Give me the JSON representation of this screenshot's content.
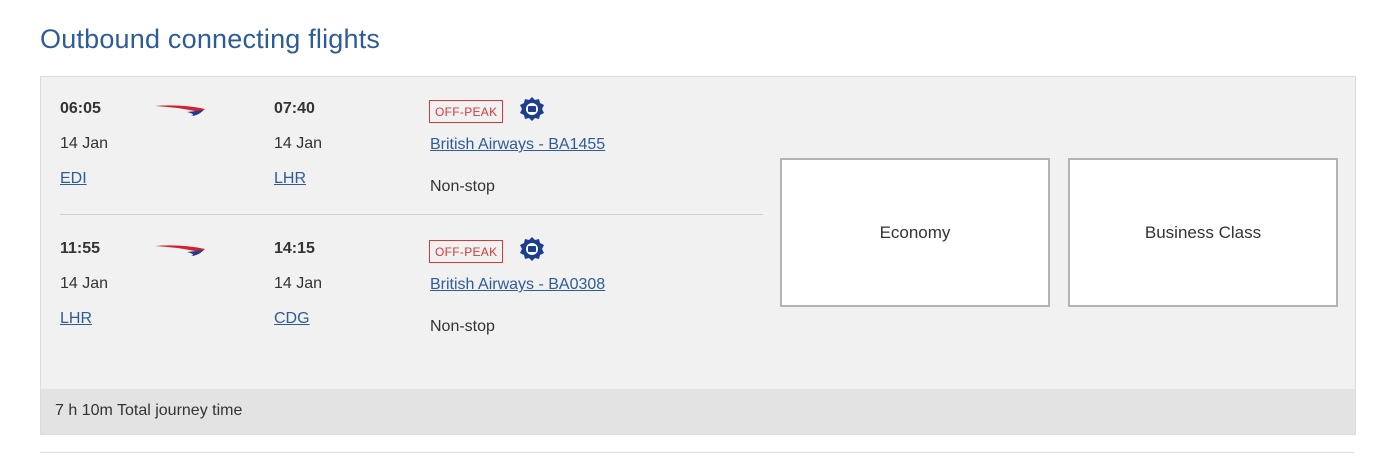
{
  "page_title": "Outbound connecting flights",
  "segments": [
    {
      "departure": {
        "time": "06:05",
        "date": "14 Jan",
        "airport": "EDI"
      },
      "arrival": {
        "time": "07:40",
        "date": "14 Jan",
        "airport": "LHR"
      },
      "fare_badge": "OFF-PEAK",
      "flight": "British Airways - BA1455",
      "stops": "Non-stop"
    },
    {
      "departure": {
        "time": "11:55",
        "date": "14 Jan",
        "airport": "LHR"
      },
      "arrival": {
        "time": "14:15",
        "date": "14 Jan",
        "airport": "CDG"
      },
      "fare_badge": "OFF-PEAK",
      "flight": "British Airways - BA0308",
      "stops": "Non-stop"
    }
  ],
  "cabins": [
    "Economy",
    "Business Class"
  ],
  "footer": {
    "journey_time": "7 h 10m Total journey time"
  },
  "icons": {
    "airline_logo": "british-airways-speedmarque-icon",
    "badge": "avios-badge-icon"
  },
  "colors": {
    "accent": "#2e5c99",
    "offpeak": "#d33a3a",
    "panel_bg": "#f1f1f1"
  }
}
